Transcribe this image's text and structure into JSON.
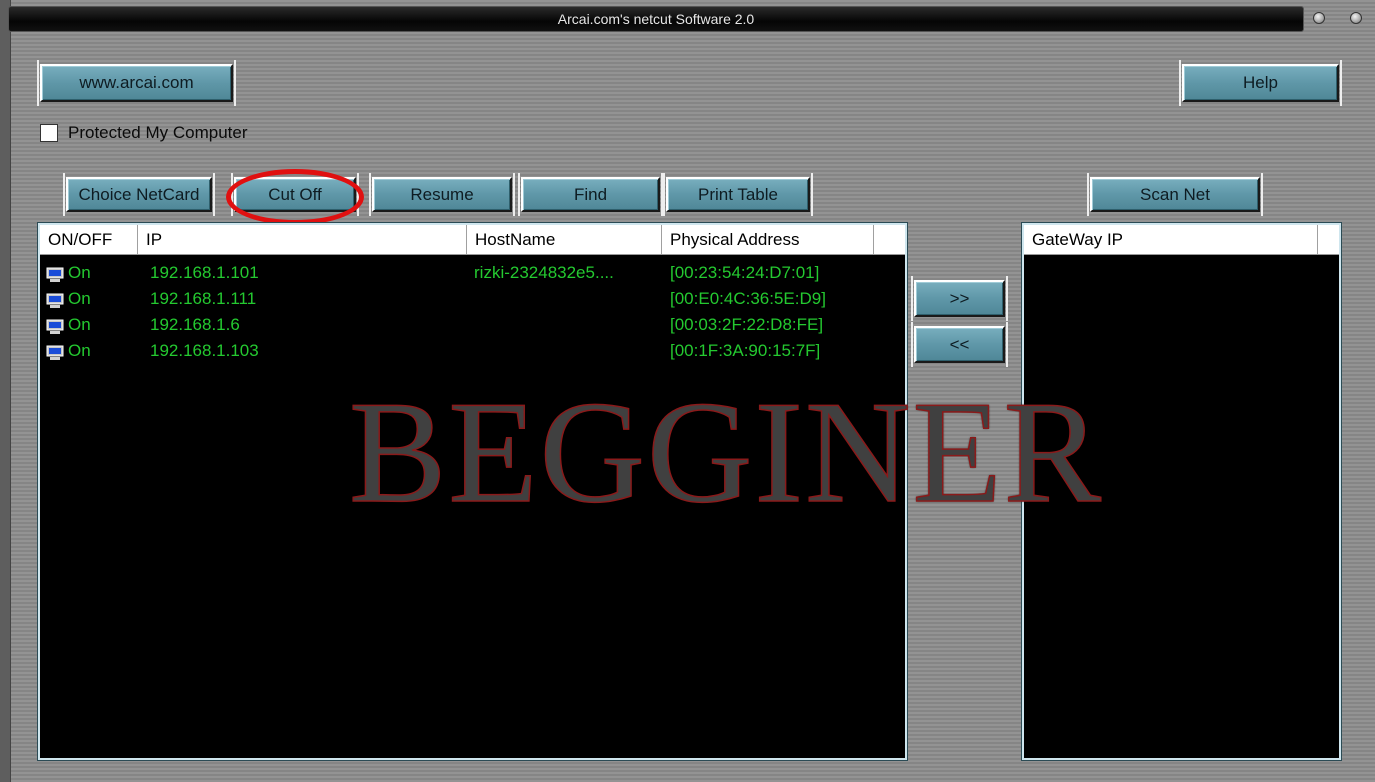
{
  "window": {
    "title": "Arcai.com's netcut Software 2.0"
  },
  "toolbar_top": {
    "website_label": "www.arcai.com",
    "help_label": "Help"
  },
  "protect": {
    "label": "Protected My Computer",
    "checked": false
  },
  "actions": {
    "choice_netcard": "Choice NetCard",
    "cut_off": "Cut Off",
    "resume": "Resume",
    "find": "Find",
    "print_table": "Print Table",
    "scan_net": "Scan Net",
    "move_right": ">>",
    "move_left": "<<"
  },
  "host_table": {
    "columns": [
      "ON/OFF",
      "IP",
      "HostName",
      "Physical Address"
    ],
    "rows": [
      {
        "status": "On",
        "ip": "192.168.1.101",
        "hostname": "rizki-2324832e5....",
        "mac": "[00:23:54:24:D7:01]"
      },
      {
        "status": "On",
        "ip": "192.168.1.111",
        "hostname": "",
        "mac": "[00:E0:4C:36:5E:D9]"
      },
      {
        "status": "On",
        "ip": "192.168.1.6",
        "hostname": "",
        "mac": "[00:03:2F:22:D8:FE]"
      },
      {
        "status": "On",
        "ip": "192.168.1.103",
        "hostname": "",
        "mac": "[00:1F:3A:90:15:7F]"
      }
    ]
  },
  "gateway_table": {
    "columns": [
      "GateWay IP"
    ]
  },
  "watermark": "BEGGINER",
  "colors": {
    "row_text": "#24c930",
    "button": "#5f97a8",
    "highlight": "#e01010"
  }
}
